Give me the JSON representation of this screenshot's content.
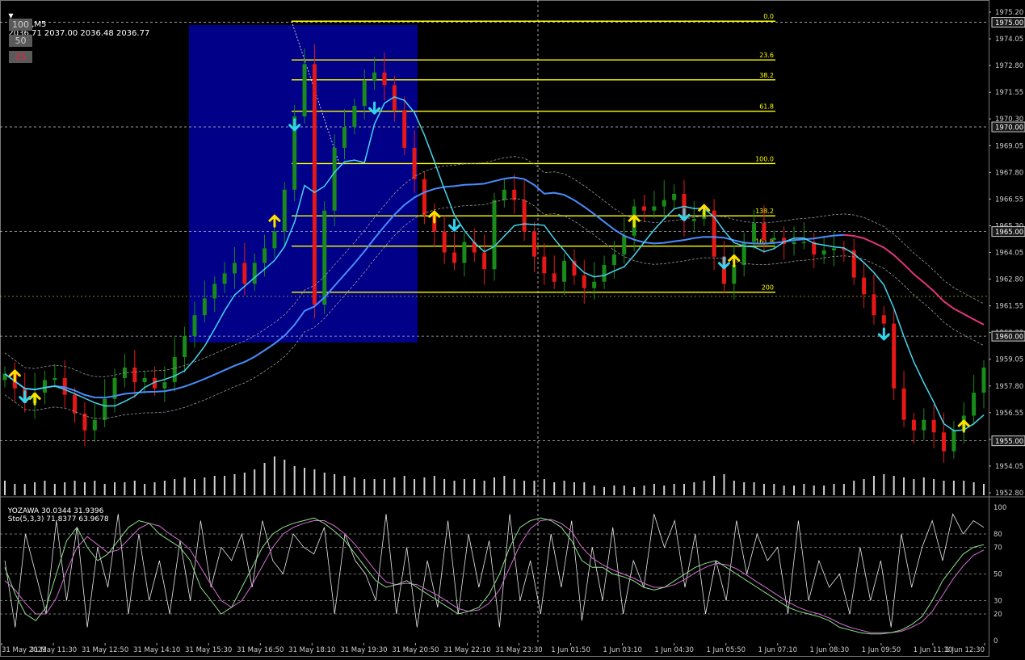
{
  "header": {
    "symbol": "GOLD,M5",
    "ohlc": "2036.71 2037.00 2036.48 2036.77",
    "sub_indicator": "YOZAWA 30.0344 31.9396",
    "sub_stoch": "Sto(5,3,3) 71.8377 63.9678"
  },
  "level_buttons": [
    "100",
    "50",
    "25"
  ],
  "colors": {
    "background": "#000000",
    "bull": "#1a8a1a",
    "bear": "#e61717",
    "fib": "#ffff00",
    "blue_box": "#0000a0",
    "fast_ma": "#46d6f0",
    "slow_ma": "#4a8cff",
    "ma_down": "#e6347c",
    "arrow_up": "#ffe000",
    "arrow_down": "#30d6f0"
  },
  "price_axis": {
    "labels": [
      "1975.20",
      "1974.05",
      "1972.80",
      "1971.55",
      "1970.30",
      "1969.05",
      "1967.80",
      "1966.55",
      "1965.30",
      "1964.05",
      "1962.80",
      "1961.55",
      "1960.30",
      "1959.05",
      "1957.80",
      "1956.55",
      "1955.30",
      "1954.05",
      "1952.80"
    ],
    "boxed": [
      "1975.00",
      "1970.00",
      "1965.00",
      "1960.00",
      "1955.00"
    ]
  },
  "stoch_axis": [
    "100",
    "80",
    "70",
    "50",
    "30",
    "20",
    "0"
  ],
  "time_axis": [
    "31 May 2023",
    "31 May 11:30",
    "31 May 12:50",
    "31 May 14:10",
    "31 May 15:30",
    "31 May 16:50",
    "31 May 18:10",
    "31 May 19:30",
    "31 May 20:50",
    "31 May 22:10",
    "31 May 23:30",
    "1 Jun 01:50",
    "1 Jun 03:10",
    "1 Jun 04:30",
    "1 Jun 05:50",
    "1 Jun 07:10",
    "1 Jun 08:30",
    "1 Jun 09:50",
    "1 Jun 11:10",
    "1 Jun 12:30"
  ],
  "fib_levels": [
    {
      "label": "0.0",
      "price": 1975.05
    },
    {
      "label": "23.6",
      "price": 1973.2
    },
    {
      "label": "38.2",
      "price": 1972.25
    },
    {
      "label": "61.8",
      "price": 1970.75
    },
    {
      "label": "100.0",
      "price": 1968.25
    },
    {
      "label": "138.2",
      "price": 1965.75
    },
    {
      "label": "161.8",
      "price": 1964.3
    },
    {
      "label": "200",
      "price": 1962.1
    }
  ],
  "series": {
    "price": [
      1958.2,
      1957.5,
      1956.8,
      1957.3,
      1957.9,
      1958.0,
      1957.2,
      1956.3,
      1955.5,
      1956.0,
      1957.0,
      1958.0,
      1958.5,
      1957.8,
      1958.0,
      1957.5,
      1957.8,
      1959.0,
      1960.0,
      1961.0,
      1961.8,
      1962.5,
      1963.0,
      1963.5,
      1962.5,
      1963.5,
      1964.2,
      1965.0,
      1967.0,
      1970.5,
      1973.0,
      1961.5,
      1966.0,
      1969.0,
      1970.0,
      1971.0,
      1972.2,
      1972.6,
      1972.0,
      1970.8,
      1969.0,
      1967.5,
      1965.8,
      1965.0,
      1964.0,
      1963.5,
      1964.5,
      1964.0,
      1963.2,
      1966.5,
      1967.0,
      1966.5,
      1965.0,
      1963.8,
      1963.0,
      1962.6,
      1963.6,
      1962.9,
      1962.3,
      1962.6,
      1963.4,
      1963.9,
      1964.8,
      1966.2,
      1966.0,
      1966.2,
      1966.5,
      1966.8,
      1965.5,
      1965.6,
      1966.0,
      1963.8,
      1962.5,
      1963.4,
      1964.5,
      1965.4,
      1964.6,
      1964.7,
      1964.4,
      1964.5,
      1964.5,
      1963.9,
      1964.1,
      1964.2,
      1964.1,
      1962.8,
      1962.0,
      1961.0,
      1960.6,
      1957.5,
      1956.0,
      1955.5,
      1956.0,
      1955.4,
      1954.5,
      1955.5,
      1956.2,
      1957.3,
      1958.5
    ]
  },
  "arrows": {
    "up": [
      [
        1,
        1958.0
      ],
      [
        3,
        1956.9
      ],
      [
        27,
        1965.4
      ],
      [
        43,
        1965.6
      ],
      [
        63,
        1965.4
      ],
      [
        70,
        1965.9
      ],
      [
        73,
        1963.5
      ],
      [
        96,
        1955.6
      ]
    ],
    "down": [
      [
        2,
        1957.2
      ],
      [
        29,
        1970.2
      ],
      [
        37,
        1971.0
      ],
      [
        45,
        1965.4
      ],
      [
        68,
        1965.9
      ],
      [
        72,
        1963.6
      ],
      [
        88,
        1960.2
      ]
    ]
  },
  "volume": [
    9,
    7,
    7,
    8,
    9,
    7,
    8,
    9,
    8,
    9,
    7,
    8,
    8,
    9,
    7,
    8,
    9,
    10,
    11,
    10,
    11,
    12,
    12,
    13,
    14,
    16,
    20,
    24,
    22,
    18,
    17,
    16,
    14,
    13,
    12,
    11,
    10,
    10,
    10,
    11,
    12,
    10,
    11,
    12,
    10,
    9,
    10,
    10,
    9,
    11,
    12,
    10,
    9,
    9,
    10,
    8,
    9,
    8,
    8,
    6,
    5,
    6,
    6,
    5,
    6,
    7,
    6,
    7,
    7,
    8,
    9,
    12,
    13,
    9,
    8,
    8,
    7,
    7,
    6,
    6,
    7,
    6,
    6,
    7,
    7,
    9,
    10,
    12,
    13,
    12,
    11,
    10,
    11,
    10,
    9,
    9,
    9,
    8,
    7
  ],
  "stoch_k": [
    55,
    35,
    20,
    15,
    25,
    50,
    75,
    85,
    70,
    60,
    65,
    75,
    85,
    90,
    88,
    80,
    75,
    70,
    60,
    40,
    30,
    20,
    25,
    40,
    55,
    70,
    80,
    85,
    88,
    90,
    92,
    88,
    82,
    75,
    65,
    55,
    45,
    40,
    42,
    45,
    40,
    35,
    30,
    25,
    20,
    22,
    25,
    35,
    50,
    70,
    85,
    90,
    92,
    90,
    85,
    75,
    60,
    55,
    55,
    50,
    48,
    45,
    40,
    38,
    40,
    45,
    50,
    55,
    58,
    60,
    55,
    50,
    45,
    40,
    35,
    30,
    25,
    22,
    20,
    18,
    15,
    10,
    8,
    6,
    5,
    5,
    6,
    8,
    12,
    18,
    30,
    45,
    55,
    65,
    70,
    72
  ],
  "stoch_d": [
    45,
    38,
    28,
    20,
    20,
    32,
    52,
    70,
    78,
    72,
    66,
    68,
    76,
    84,
    88,
    86,
    80,
    75,
    68,
    55,
    42,
    30,
    25,
    30,
    42,
    56,
    70,
    80,
    85,
    88,
    90,
    90,
    86,
    80,
    72,
    62,
    52,
    44,
    42,
    43,
    42,
    38,
    34,
    29,
    24,
    22,
    23,
    28,
    38,
    55,
    72,
    84,
    90,
    91,
    88,
    82,
    70,
    62,
    57,
    53,
    50,
    47,
    43,
    40,
    40,
    42,
    46,
    51,
    55,
    58,
    57,
    54,
    49,
    44,
    39,
    34,
    29,
    25,
    22,
    20,
    17,
    13,
    10,
    8,
    6,
    6,
    6,
    7,
    10,
    14,
    22,
    34,
    46,
    56,
    64,
    68
  ],
  "yozawa": [
    60,
    10,
    80,
    50,
    20,
    90,
    30,
    85,
    10,
    70,
    40,
    95,
    20,
    80,
    30,
    60,
    20,
    75,
    30,
    90,
    40,
    70,
    60,
    80,
    40,
    90,
    60,
    50,
    80,
    70,
    65,
    85,
    20,
    80,
    60,
    50,
    30,
    95,
    20,
    70,
    10,
    60,
    25,
    90,
    20,
    80,
    40,
    75,
    10,
    95,
    30,
    60,
    20,
    80,
    40,
    90,
    15,
    70,
    30,
    85,
    20,
    60,
    40,
    95,
    70,
    90,
    40,
    80,
    20,
    60,
    30,
    90,
    50,
    80,
    60,
    70,
    20,
    90,
    30,
    60,
    40,
    50,
    20,
    70,
    30,
    60,
    10,
    80,
    40,
    70,
    90,
    60,
    95,
    80,
    90,
    85
  ]
}
